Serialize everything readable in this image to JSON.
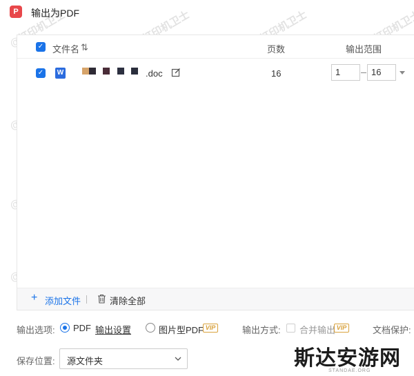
{
  "window": {
    "title": "输出为PDF",
    "logo_glyph": "P"
  },
  "table": {
    "headers": {
      "filename": "文件名",
      "sort_glyph": "⇅",
      "pages": "页数",
      "range": "输出范围"
    },
    "rows": [
      {
        "checked": true,
        "file_type_glyph": "W",
        "filename": ".doc",
        "pages": "16",
        "range_start": "1",
        "range_end": "16"
      }
    ]
  },
  "footer": {
    "add_file": "添加文件",
    "add_glyph": "+",
    "clear_all": "清除全部"
  },
  "options": {
    "label": "输出选项:",
    "pdf_label": "PDF",
    "pdf_selected": true,
    "settings_link": "输出设置",
    "image_pdf_label": "图片型PDF",
    "vip_badge": "VIP",
    "output_mode_label": "输出方式:",
    "merge_label": "合并输出",
    "protection_label": "文档保护:"
  },
  "save": {
    "label": "保存位置:",
    "value": "源文件夹"
  },
  "watermarks": {
    "text": "@打印机卫士",
    "brand": "斯达安游网",
    "brand_sub": "STANDAE.ORG"
  },
  "colors": {
    "accent": "#1a73e8",
    "vip": "#d9a23c",
    "logo": "#e8474a",
    "word": "#2b6bde"
  }
}
